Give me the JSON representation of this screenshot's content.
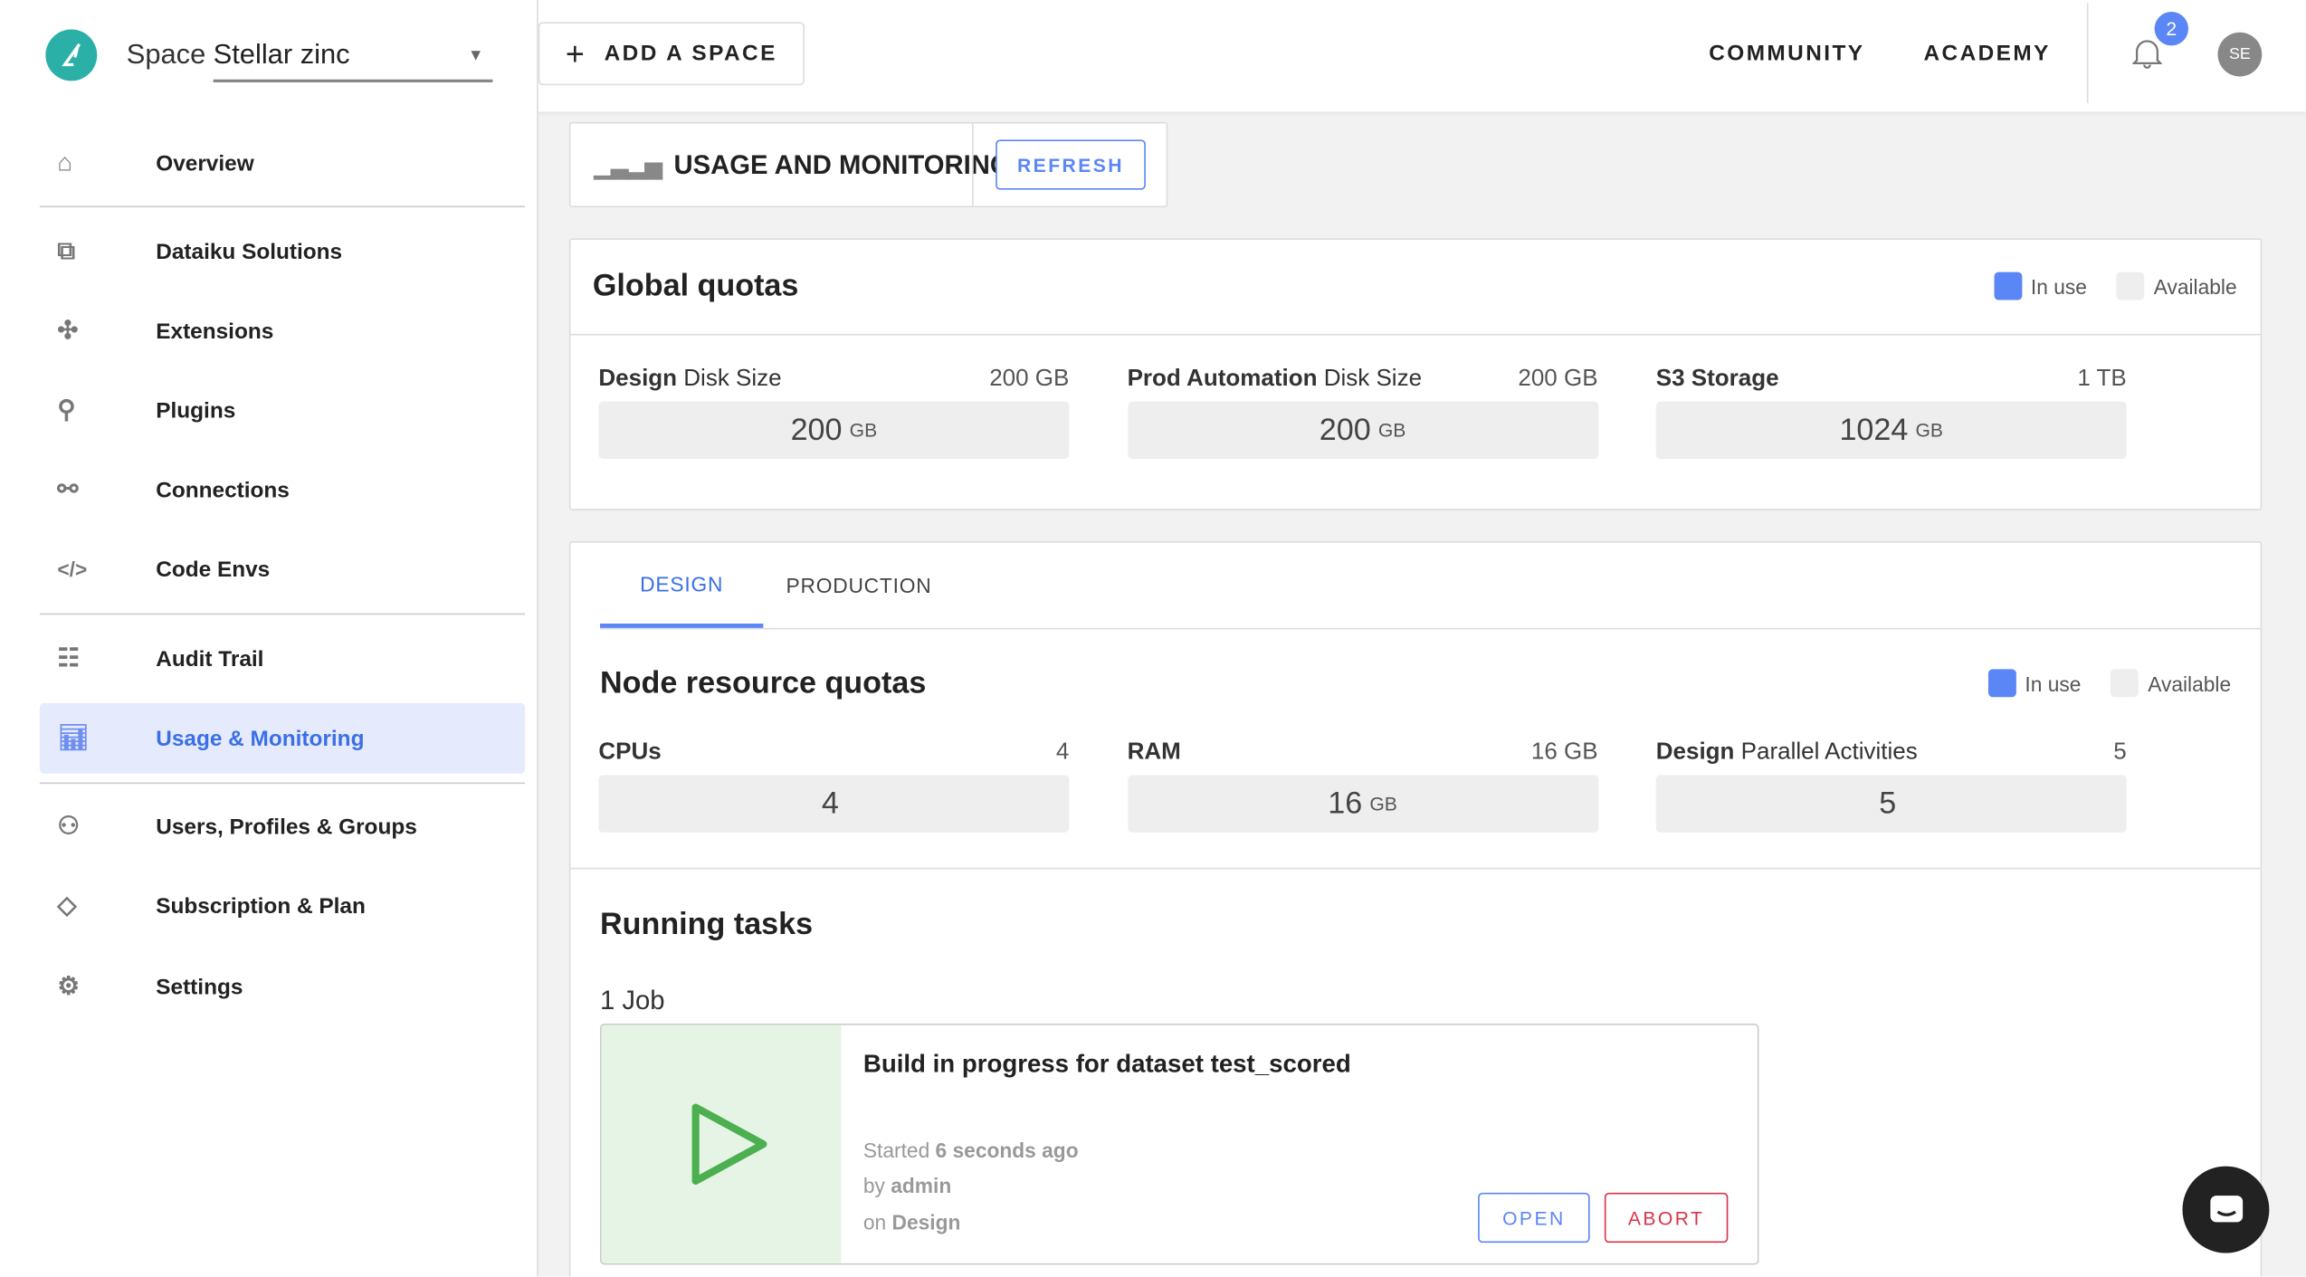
{
  "header": {
    "space_label": "Space",
    "space_value": "Stellar zinc",
    "add_space": "ADD A SPACE",
    "community": "COMMUNITY",
    "academy": "ACADEMY",
    "notif_count": "2",
    "avatar": "SE"
  },
  "sidebar": {
    "items": [
      {
        "label": "Overview",
        "icon": "home-icon"
      },
      {
        "label": "Dataiku Solutions",
        "icon": "solutions-icon"
      },
      {
        "label": "Extensions",
        "icon": "puzzle-icon"
      },
      {
        "label": "Plugins",
        "icon": "plug-icon"
      },
      {
        "label": "Connections",
        "icon": "connections-icon"
      },
      {
        "label": "Code Envs",
        "icon": "code-icon"
      },
      {
        "label": "Audit Trail",
        "icon": "clipboard-icon"
      },
      {
        "label": "Usage & Monitoring",
        "icon": "bar-chart-icon"
      },
      {
        "label": "Users, Profiles & Groups",
        "icon": "users-icon"
      },
      {
        "label": "Subscription & Plan",
        "icon": "diamond-icon"
      },
      {
        "label": "Settings",
        "icon": "gear-icon"
      }
    ]
  },
  "page": {
    "title": "USAGE AND MONITORING",
    "refresh": "REFRESH"
  },
  "legend": {
    "in_use": "In use",
    "available": "Available"
  },
  "colors": {
    "accent": "#5b86f5",
    "in_use": "#5b86f5",
    "available": "#eeeeee",
    "abort": "#d9334a",
    "job_green": "#4caf50"
  },
  "global": {
    "title": "Global quotas",
    "quotas": [
      {
        "bold": "Design",
        "rest": " Disk Size",
        "total": "200 GB",
        "value": "200",
        "unit": "GB"
      },
      {
        "bold": "Prod Automation",
        "rest": " Disk Size",
        "total": "200 GB",
        "value": "200",
        "unit": "GB"
      },
      {
        "bold": "S3 Storage",
        "rest": "",
        "total": "1 TB",
        "value": "1024",
        "unit": "GB"
      }
    ]
  },
  "tabs": [
    "DESIGN",
    "PRODUCTION"
  ],
  "node": {
    "title": "Node resource quotas",
    "quotas": [
      {
        "bold": "CPUs",
        "rest": "",
        "total": "4",
        "value": "4",
        "unit": ""
      },
      {
        "bold": "RAM",
        "rest": "",
        "total": "16 GB",
        "value": "16",
        "unit": "GB"
      },
      {
        "bold": "Design",
        "rest": " Parallel Activities",
        "total": "5",
        "value": "5",
        "unit": ""
      }
    ]
  },
  "tasks": {
    "title": "Running tasks",
    "count": "1 Job",
    "job": {
      "title": "Build in progress for dataset test_scored",
      "started_pre": "Started ",
      "started": "6 seconds ago",
      "by_pre": "by ",
      "by": "admin",
      "on_pre": "on ",
      "on": "Design",
      "open": "OPEN",
      "abort": "ABORT"
    }
  }
}
